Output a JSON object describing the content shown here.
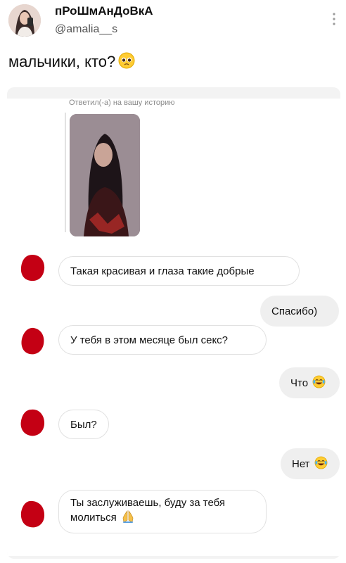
{
  "post": {
    "author_name": "пРоШмАнДоВкА",
    "author_handle": "@amalia__s",
    "text": "мальчики, кто?",
    "emoji_icon": "pleading-face-emoji",
    "more_icon": "vertical-dots-icon"
  },
  "screenshot": {
    "reply_caption": "Ответил(-а) на вашу историю",
    "messages": [
      {
        "side": "them",
        "text": "Такая красивая и глаза такие добрые"
      },
      {
        "side": "me",
        "text": "Спасибо)"
      },
      {
        "side": "them",
        "text": "У тебя в этом месяце был секс?"
      },
      {
        "side": "me",
        "text": "Что",
        "emoji": "laughing-tears-emoji"
      },
      {
        "side": "them",
        "text": "Был?"
      },
      {
        "side": "me",
        "text": "Нет",
        "emoji": "laughing-tears-emoji"
      },
      {
        "side": "them",
        "text": "Ты заслуживаешь, буду за тебя молиться",
        "emoji": "praying-hands-emoji"
      }
    ]
  },
  "colors": {
    "redaction": "#c40014",
    "bubble_me": "#efefef",
    "bubble_border": "#e1e1e1"
  }
}
